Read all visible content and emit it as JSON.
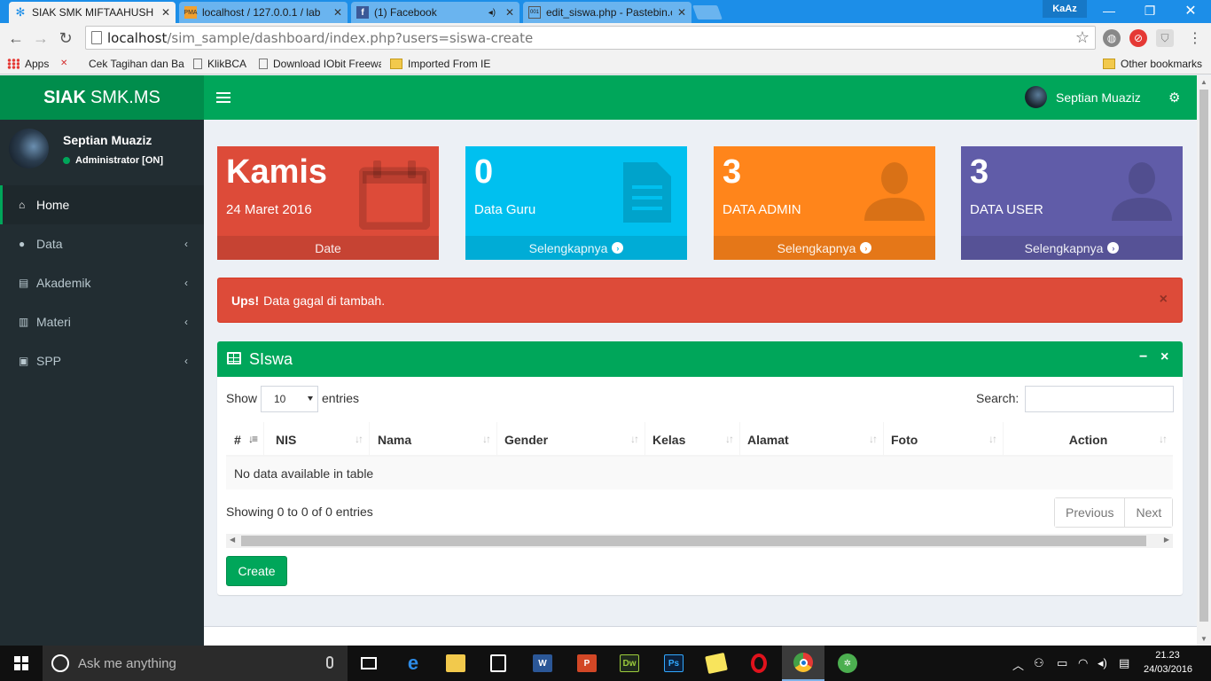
{
  "browser": {
    "tabs": [
      {
        "title": "SIAK SMK MIFTAAHUSH SHOLIHIN",
        "active": true
      },
      {
        "title": "localhost / 127.0.0.1 / lab",
        "active": false
      },
      {
        "title": "(1) Facebook",
        "active": false
      },
      {
        "title": "edit_siswa.php - Pastebin.com",
        "active": false
      }
    ],
    "profile_badge": "KaAz",
    "url_host": "localhost",
    "url_path": "/sim_sample/dashboard/index.php?users=siswa-create",
    "bookmarks": [
      {
        "label": "Apps",
        "icon": "apps-grid-icon"
      },
      {
        "label": "Cek Tagihan dan Bayar",
        "icon": "bebas-bayar-icon"
      },
      {
        "label": "KlikBCA",
        "icon": "page-icon"
      },
      {
        "label": "Download IObit Freeware",
        "icon": "page-icon"
      },
      {
        "label": "Imported From IE",
        "icon": "folder-icon"
      },
      {
        "label": "Other bookmarks",
        "icon": "folder-icon"
      }
    ]
  },
  "header": {
    "logo_bold": "SIAK",
    "logo_rest": "SMK.MS",
    "user_name": "Septian Muaziz"
  },
  "sidebar": {
    "user_name": "Septian Muaziz",
    "user_status": "Administrator [ON]",
    "items": [
      {
        "label": "Home",
        "icon": "home-icon",
        "active": true
      },
      {
        "label": "Data",
        "icon": "user-icon"
      },
      {
        "label": "Akademik",
        "icon": "file-icon"
      },
      {
        "label": "Materi",
        "icon": "book-icon"
      },
      {
        "label": "SPP",
        "icon": "money-icon"
      }
    ]
  },
  "stats": [
    {
      "value": "Kamis",
      "label": "24 Maret 2016",
      "footer": "Date",
      "color": "#dd4b39",
      "icon": "calendar-icon"
    },
    {
      "value": "0",
      "label": "Data Guru",
      "footer": "Selengkapnya",
      "color": "#00c0ef",
      "icon": "document-icon"
    },
    {
      "value": "3",
      "label": "DATA ADMIN",
      "footer": "Selengkapnya",
      "color": "#ff851b",
      "icon": "person-icon"
    },
    {
      "value": "3",
      "label": "DATA USER",
      "footer": "Selengkapnya",
      "color": "#605ca8",
      "icon": "person-icon"
    }
  ],
  "alert": {
    "strong": "Ups!",
    "message": "Data gagal di tambah."
  },
  "box": {
    "title": "SIswa",
    "show_label": "Show",
    "page_length": "10",
    "entries_label": "entries",
    "search_label": "Search:",
    "columns": [
      "#",
      "NIS",
      "Nama",
      "Gender",
      "Kelas",
      "Alamat",
      "Foto",
      "Action"
    ],
    "empty_message": "No data available in table",
    "info": "Showing 0 to 0 of 0 entries",
    "prev_label": "Previous",
    "next_label": "Next",
    "create_label": "Create"
  },
  "taskbar": {
    "search_placeholder": "Ask me anything",
    "time": "21.23",
    "date": "24/03/2016"
  }
}
